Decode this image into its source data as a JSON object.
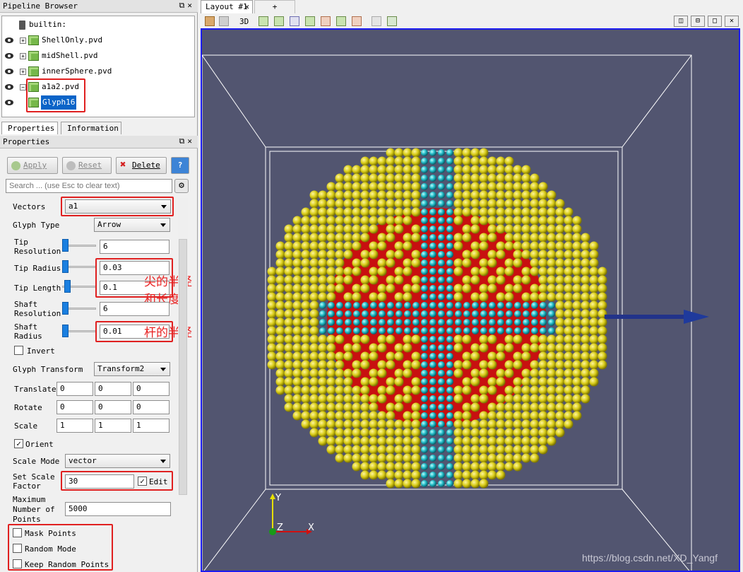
{
  "pipeline": {
    "title": "Pipeline Browser",
    "items": [
      {
        "label": "builtin:"
      },
      {
        "label": "ShellOnly.pvd"
      },
      {
        "label": "midShell.pvd"
      },
      {
        "label": "innerSphere.pvd"
      },
      {
        "label": "a1a2.pvd"
      },
      {
        "label": "Glyph16"
      }
    ]
  },
  "tabs": {
    "properties": "Properties",
    "information": "Information"
  },
  "properties": {
    "title": "Properties",
    "apply": "Apply",
    "reset": "Reset",
    "delete": "Delete",
    "help": "?",
    "search_placeholder": "Search ... (use Esc to clear text)",
    "vectors_label": "Vectors",
    "vectors_value": "a1",
    "glyph_type_label": "Glyph Type",
    "glyph_type_value": "Arrow",
    "tip_resolution_label": "Tip Resolution",
    "tip_resolution_value": "6",
    "tip_radius_label": "Tip Radius",
    "tip_radius_value": "0.03",
    "tip_length_label": "Tip Length",
    "tip_length_value": "0.1",
    "shaft_resolution_label": "Shaft Resolution",
    "shaft_resolution_value": "6",
    "shaft_radius_label": "Shaft Radius",
    "shaft_radius_value": "0.01",
    "invert_label": "Invert",
    "glyph_transform_label": "Glyph Transform",
    "glyph_transform_value": "Transform2",
    "translate_label": "Translate",
    "translate": [
      "0",
      "0",
      "0"
    ],
    "rotate_label": "Rotate",
    "rotate": [
      "0",
      "0",
      "0"
    ],
    "scale_label": "Scale",
    "scale": [
      "1",
      "1",
      "1"
    ],
    "orient_label": "Orient",
    "scale_mode_label": "Scale Mode",
    "scale_mode_value": "vector",
    "set_scale_factor_label": "Set Scale Factor",
    "set_scale_factor_value": "30",
    "edit_label": "Edit",
    "max_points_label": "Maximum Number of Points",
    "max_points_value": "5000",
    "mask_points_label": "Mask Points",
    "random_mode_label": "Random Mode",
    "keep_random_label": "Keep Random Points"
  },
  "annotations": {
    "tip": "尖的半径和长度",
    "shaft": "杆的半径"
  },
  "layout": {
    "tab_label": "Layout #1",
    "add_tab": "+",
    "mode_3d": "3D"
  },
  "axes": {
    "y": "Y",
    "z": "Z",
    "x": "X"
  },
  "watermark": "https://blog.csdn.net/XD_Yangf",
  "colors": {
    "background": "#525570",
    "outer_shell": "#d6c81a",
    "mid_shell": "#c81010",
    "inner_core": "#22bcc8",
    "arrow": "#1f3a9c",
    "highlight": "#e02020"
  }
}
